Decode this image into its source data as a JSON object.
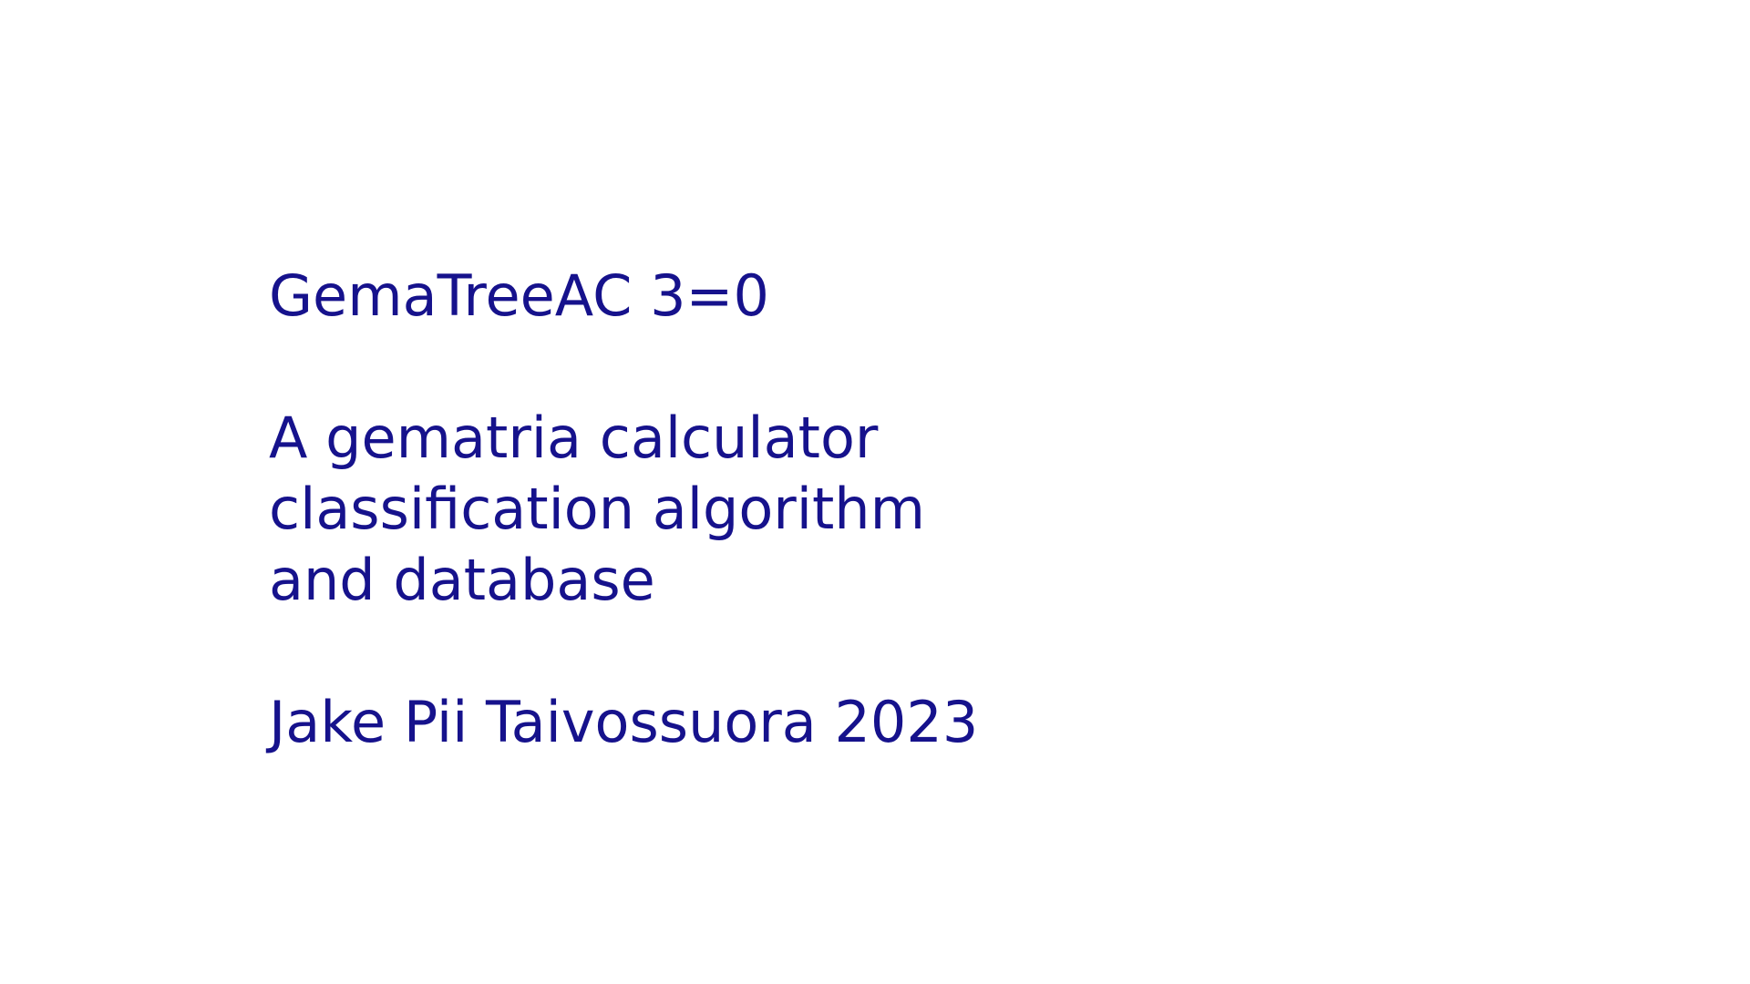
{
  "slide": {
    "title": "GemaTreeAC 3=0",
    "description_lines": [
      "A gematria calculator",
      "classification algorithm",
      "and database"
    ],
    "author_line": "Jake Pii Taivossuora 2023",
    "text_color": "#16128c",
    "background_color": "#ffffff"
  }
}
